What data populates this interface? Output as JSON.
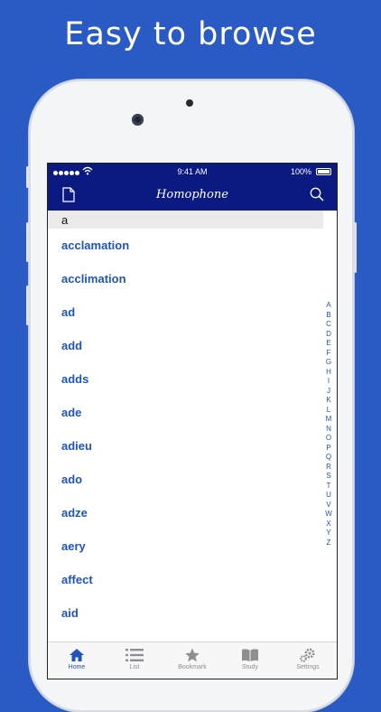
{
  "headline": "Easy to browse",
  "status_bar": {
    "time": "9:41 AM",
    "battery": "100%"
  },
  "nav": {
    "title": "Homophone",
    "left_icon": "document-icon",
    "right_icon": "search-icon"
  },
  "section_header": "a",
  "words": [
    "acclamation",
    "acclimation",
    "ad",
    "add",
    "adds",
    "ade",
    "adieu",
    "ado",
    "adze",
    "aery",
    "affect",
    "aid"
  ],
  "index_letters": [
    "A",
    "B",
    "C",
    "D",
    "E",
    "F",
    "G",
    "H",
    "I",
    "J",
    "K",
    "L",
    "M",
    "N",
    "O",
    "P",
    "Q",
    "R",
    "S",
    "T",
    "U",
    "V",
    "W",
    "X",
    "Y",
    "Z"
  ],
  "tabs": [
    {
      "label": "Home",
      "icon": "home-icon",
      "active": true
    },
    {
      "label": "List",
      "icon": "list-icon",
      "active": false
    },
    {
      "label": "Bookmark",
      "icon": "star-icon",
      "active": false
    },
    {
      "label": "Study",
      "icon": "book-icon",
      "active": false
    },
    {
      "label": "Settings",
      "icon": "gear-icon",
      "active": false
    }
  ],
  "colors": {
    "background": "#2a5bc4",
    "navbar": "#0b1a80",
    "accent": "#1f54b8"
  }
}
